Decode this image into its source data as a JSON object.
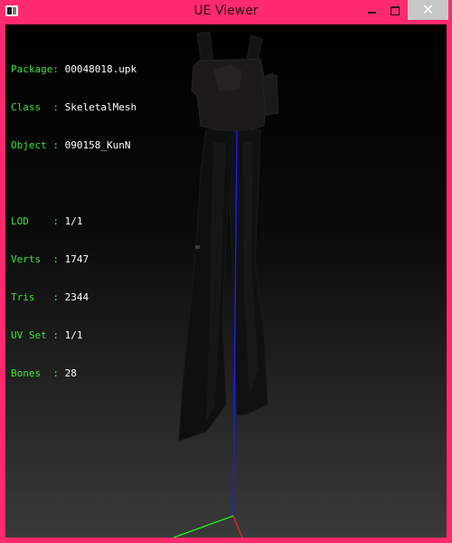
{
  "window": {
    "title": "UE Viewer",
    "close_glyph": "✕",
    "accent_color": "#ff2a6d"
  },
  "icons": {
    "app": "app-icon",
    "minimize": "minimize-icon",
    "maximize": "maximize-icon",
    "close": "close-icon"
  },
  "info": {
    "package": {
      "label": "Package:",
      "value": "00048018.upk"
    },
    "class": {
      "label": "Class  :",
      "value": "SkeletalMesh"
    },
    "object": {
      "label": "Object :",
      "value": "090158_KunN"
    },
    "lod": {
      "label": "LOD    :",
      "value": "1/1"
    },
    "verts": {
      "label": "Verts  :",
      "value": "1747"
    },
    "tris": {
      "label": "Tris   :",
      "value": "2344"
    },
    "uvset": {
      "label": "UV Set :",
      "value": "1/1"
    },
    "bones": {
      "label": "Bones  :",
      "value": "28"
    }
  },
  "scene": {
    "axis_colors": {
      "x": "#ff2020",
      "y": "#20ff20",
      "z": "#2020ff"
    }
  }
}
